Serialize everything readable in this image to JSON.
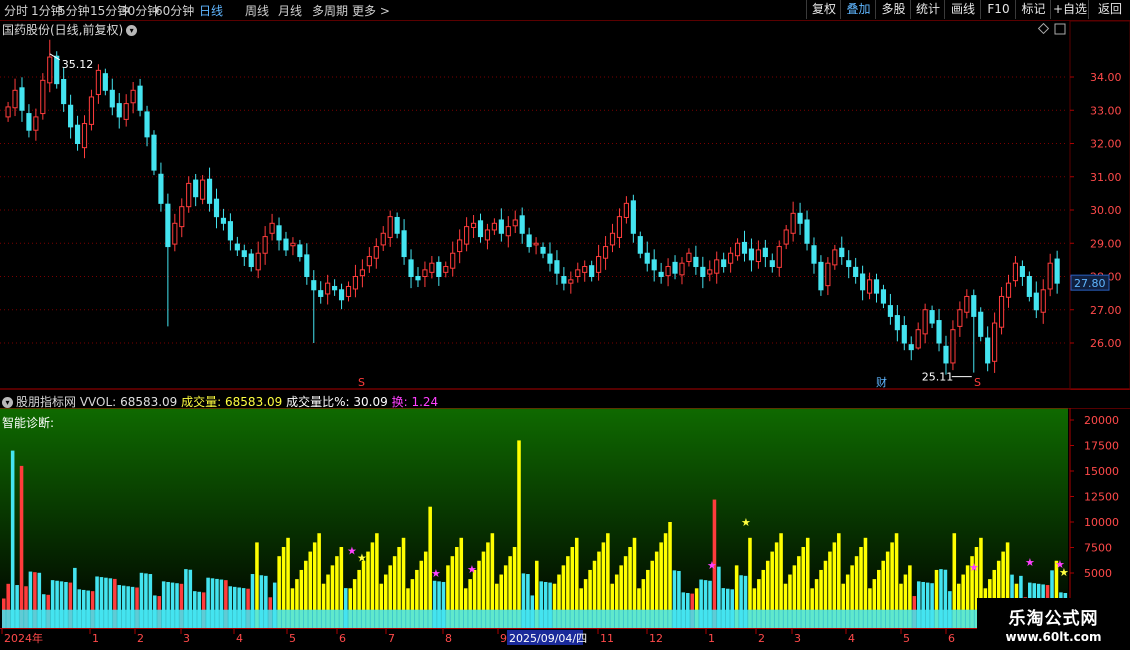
{
  "toolbar": {
    "periods": [
      "分时",
      "1分钟",
      "5分钟",
      "15分钟",
      "30分钟",
      "60分钟",
      "日线",
      "周线",
      "月线",
      "多周期",
      "更多 >"
    ],
    "active_period": "日线",
    "right_buttons": [
      "复权",
      "叠加",
      "多股",
      "统计",
      "画线",
      "F10",
      "标记",
      "+自选",
      "返回"
    ],
    "active_right": "叠加"
  },
  "price_panel": {
    "title": "国药股份(日线,前复权)",
    "high_label": "35.12",
    "low_label": "25.11",
    "current_price": "27.80",
    "y_ticks": [
      "34.00",
      "33.00",
      "32.00",
      "31.00",
      "30.00",
      "29.00",
      "28.00",
      "27.00",
      "26.00"
    ],
    "markers": [
      "S",
      "财",
      "S"
    ]
  },
  "indicator_panel": {
    "name": "股朋指标网",
    "vol_label": "VVOL:",
    "vol_value": "68583.09",
    "volume_label": "成交量:",
    "volume_value": "68583.09",
    "ratio_label": "成交量比%:",
    "ratio_value": "30.09",
    "turnover_label": "换:",
    "turnover_value": "1.24",
    "diagnosis_label": "智能诊断:",
    "y_ticks": [
      "20000",
      "17500",
      "15000",
      "12500",
      "10000",
      "7500",
      "5000"
    ]
  },
  "time_axis": {
    "labels": [
      "2024年",
      "1",
      "2",
      "3",
      "4",
      "5",
      "6",
      "7",
      "8",
      "9",
      "2025/09/04/四",
      "11",
      "12",
      "1",
      "2",
      "3",
      "4",
      "5",
      "6"
    ]
  },
  "watermark": {
    "line1": "乐淘公式网",
    "line2": "www.60lt.com"
  },
  "colors": {
    "up": "#ff3c3c",
    "down": "#44e4f0",
    "highlight": "#ffff00",
    "grid": "#7a0000",
    "star_magenta": "#ff40ff",
    "star_yellow": "#ffff40"
  },
  "chart_data": {
    "type": "candlestick",
    "price_ylim": [
      25.0,
      35.5
    ],
    "volume_ylim": [
      0,
      21000
    ],
    "closes": [
      33.1,
      33.6,
      33.0,
      32.4,
      32.8,
      33.9,
      34.6,
      33.8,
      33.2,
      32.5,
      32.0,
      32.6,
      33.4,
      34.2,
      33.6,
      33.1,
      32.8,
      33.2,
      33.6,
      33.0,
      32.2,
      31.2,
      30.2,
      28.9,
      29.6,
      30.1,
      30.8,
      30.4,
      30.9,
      30.2,
      29.8,
      29.6,
      29.1,
      28.8,
      28.6,
      28.3,
      28.7,
      29.2,
      29.6,
      29.1,
      28.8,
      29.0,
      28.6,
      28.0,
      27.6,
      27.4,
      27.8,
      27.6,
      27.3,
      27.7,
      28.0,
      28.2,
      28.6,
      28.9,
      29.3,
      29.8,
      29.3,
      28.6,
      28.0,
      27.9,
      28.2,
      28.4,
      28.0,
      28.3,
      28.7,
      29.1,
      29.5,
      29.6,
      29.2,
      29.4,
      29.6,
      29.3,
      29.5,
      29.7,
      29.3,
      28.9,
      29.0,
      28.7,
      28.4,
      28.1,
      27.8,
      27.9,
      28.2,
      28.3,
      28.0,
      28.6,
      28.9,
      29.3,
      29.8,
      30.2,
      29.3,
      28.7,
      28.4,
      28.2,
      28.0,
      28.3,
      28.1,
      28.4,
      28.7,
      28.3,
      28.0,
      28.2,
      28.5,
      28.3,
      28.7,
      29.0,
      28.7,
      28.5,
      28.8,
      28.6,
      28.3,
      28.9,
      29.4,
      29.9,
      29.6,
      29.0,
      28.4,
      27.6,
      28.4,
      28.8,
      28.6,
      28.3,
      28.0,
      27.6,
      27.9,
      27.5,
      27.2,
      26.8,
      26.4,
      26.0,
      25.8,
      26.4,
      27.0,
      26.6,
      26.0,
      25.4,
      26.4,
      27.0,
      27.4,
      26.8,
      26.2,
      25.4,
      26.6,
      27.4,
      27.8,
      28.4,
      28.0,
      27.4,
      27.0,
      27.6,
      28.4,
      27.8
    ]
  }
}
